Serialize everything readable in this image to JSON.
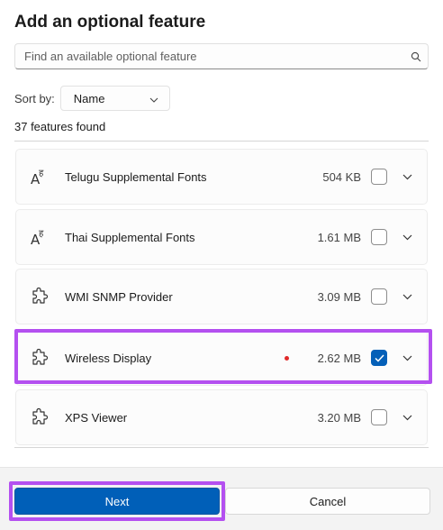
{
  "dialog": {
    "title": "Add an optional feature"
  },
  "search": {
    "placeholder": "Find an available optional feature"
  },
  "sort": {
    "label": "Sort by:",
    "selected": "Name"
  },
  "results": {
    "count_text": "37 features found"
  },
  "features": [
    {
      "name": "Telugu Supplemental Fonts",
      "size": "504 KB",
      "checked": false,
      "icon": "font-icon"
    },
    {
      "name": "Thai Supplemental Fonts",
      "size": "1.61 MB",
      "checked": false,
      "icon": "font-icon"
    },
    {
      "name": "WMI SNMP Provider",
      "size": "3.09 MB",
      "checked": false,
      "icon": "puzzle-icon"
    },
    {
      "name": "Wireless Display",
      "size": "2.62 MB",
      "checked": true,
      "icon": "puzzle-icon"
    },
    {
      "name": "XPS Viewer",
      "size": "3.20 MB",
      "checked": false,
      "icon": "puzzle-icon"
    }
  ],
  "footer": {
    "next_label": "Next",
    "cancel_label": "Cancel"
  },
  "colors": {
    "accent": "#005fb8",
    "highlight": "#b450f0",
    "marker": "#e02a2a"
  }
}
